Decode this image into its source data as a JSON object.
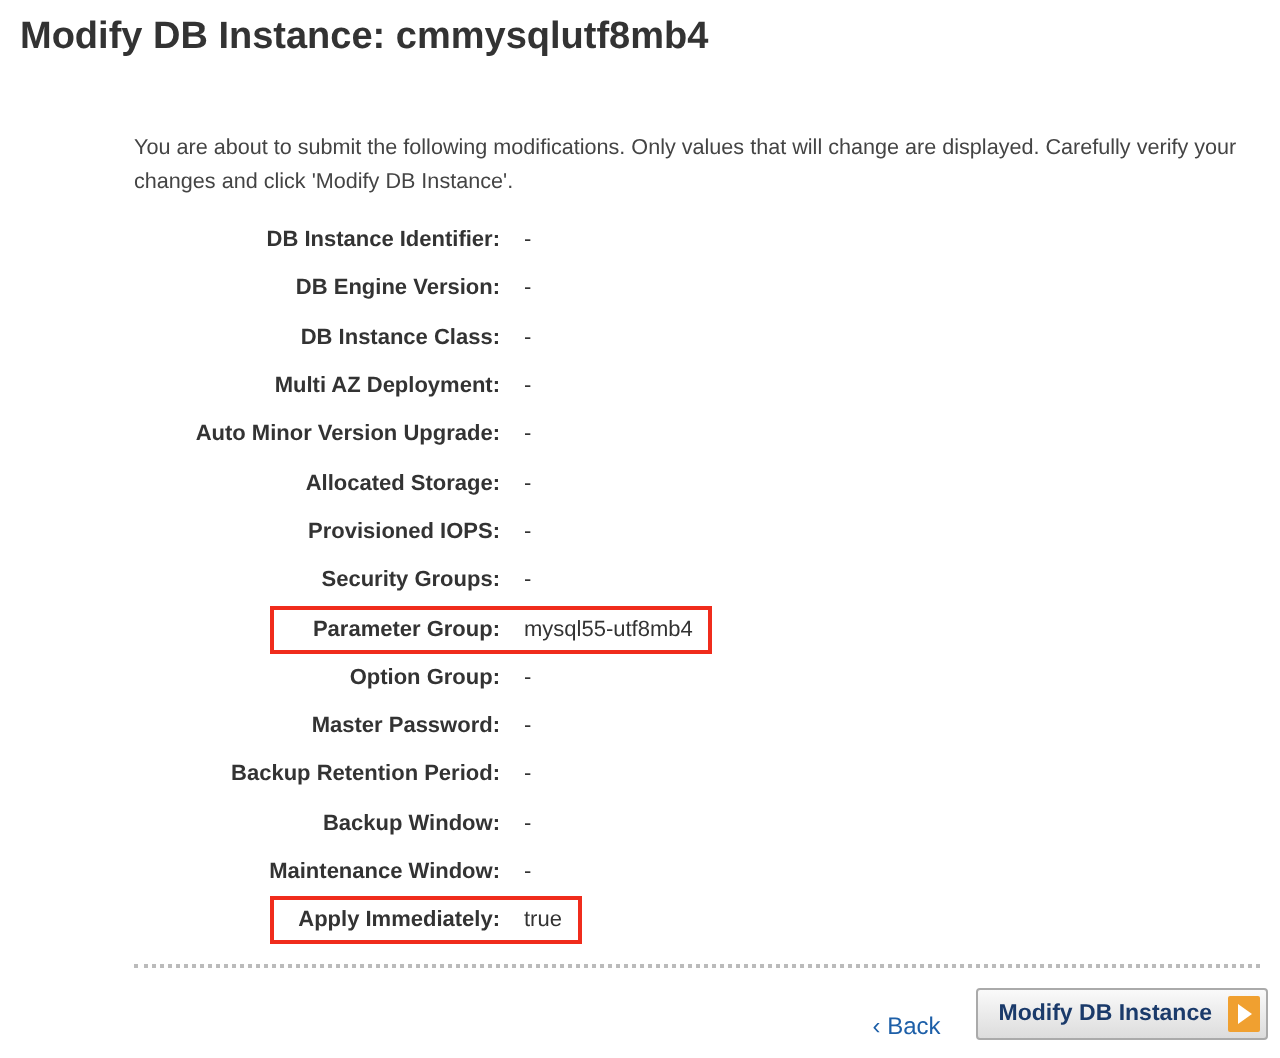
{
  "title": "Modify DB Instance: cmmysqlutf8mb4",
  "intro": "You are about to submit the following modifications. Only values that will change are displayed. Carefully verify your changes and click 'Modify DB Instance'.",
  "rows": [
    {
      "label": "DB Instance Identifier:",
      "value": "-",
      "highlighted": false
    },
    {
      "label": "DB Engine Version:",
      "value": "-",
      "highlighted": false
    },
    {
      "label": "DB Instance Class:",
      "value": "-",
      "highlighted": false
    },
    {
      "label": "Multi AZ Deployment:",
      "value": "-",
      "highlighted": false
    },
    {
      "label": "Auto Minor Version Upgrade:",
      "value": "-",
      "highlighted": false
    },
    {
      "label": "Allocated Storage:",
      "value": "-",
      "highlighted": false
    },
    {
      "label": "Provisioned IOPS:",
      "value": "-",
      "highlighted": false
    },
    {
      "label": "Security Groups:",
      "value": "-",
      "highlighted": false
    },
    {
      "label": "Parameter Group:",
      "value": "mysql55-utf8mb4",
      "highlighted": true
    },
    {
      "label": "Option Group:",
      "value": "-",
      "highlighted": false
    },
    {
      "label": "Master Password:",
      "value": "-",
      "highlighted": false
    },
    {
      "label": "Backup Retention Period:",
      "value": "-",
      "highlighted": false
    },
    {
      "label": "Backup Window:",
      "value": "-",
      "highlighted": false
    },
    {
      "label": "Maintenance Window:",
      "value": "-",
      "highlighted": false
    },
    {
      "label": "Apply Immediately:",
      "value": "true",
      "highlighted": true
    }
  ],
  "back_link": "‹ Back",
  "submit_button": "Modify DB Instance"
}
